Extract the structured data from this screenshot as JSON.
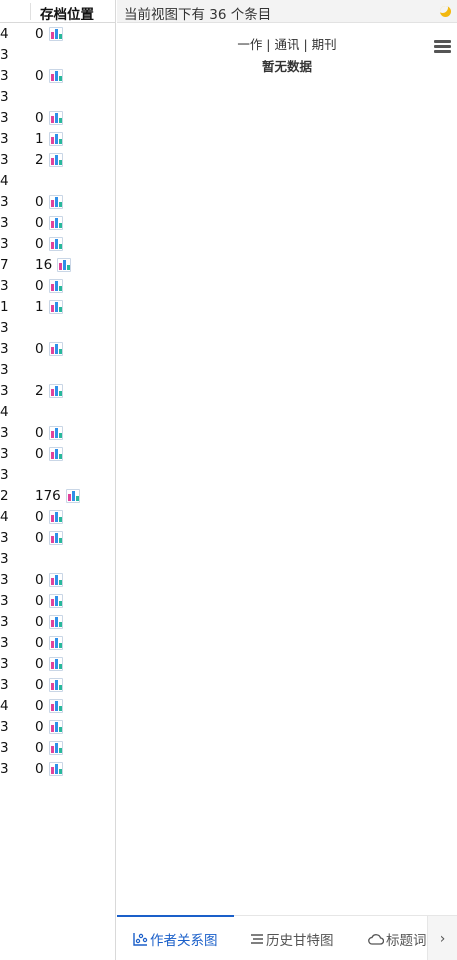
{
  "table": {
    "header": "存档位置",
    "rows": [
      {
        "c1": "4",
        "num": "0",
        "icon": true
      },
      {
        "c1": "3",
        "num": "",
        "icon": false
      },
      {
        "c1": "3",
        "num": "0",
        "icon": true
      },
      {
        "c1": "3",
        "num": "",
        "icon": false
      },
      {
        "c1": "3",
        "num": "0",
        "icon": true
      },
      {
        "c1": "3",
        "num": "1",
        "icon": true
      },
      {
        "c1": "3",
        "num": "2",
        "icon": true
      },
      {
        "c1": "4",
        "num": "",
        "icon": false
      },
      {
        "c1": "3",
        "num": "0",
        "icon": true
      },
      {
        "c1": "3",
        "num": "0",
        "icon": true
      },
      {
        "c1": "3",
        "num": "0",
        "icon": true
      },
      {
        "c1": "7",
        "num": "16",
        "icon": true
      },
      {
        "c1": "3",
        "num": "0",
        "icon": true
      },
      {
        "c1": "1",
        "num": "1",
        "icon": true
      },
      {
        "c1": "3",
        "num": "",
        "icon": false
      },
      {
        "c1": "3",
        "num": "0",
        "icon": true
      },
      {
        "c1": "3",
        "num": "",
        "icon": false
      },
      {
        "c1": "3",
        "num": "2",
        "icon": true
      },
      {
        "c1": "4",
        "num": "",
        "icon": false
      },
      {
        "c1": "3",
        "num": "0",
        "icon": true
      },
      {
        "c1": "3",
        "num": "0",
        "icon": true
      },
      {
        "c1": "3",
        "num": "",
        "icon": false
      },
      {
        "c1": "2",
        "num": "176",
        "icon": true
      },
      {
        "c1": "4",
        "num": "0",
        "icon": true
      },
      {
        "c1": "3",
        "num": "0",
        "icon": true
      },
      {
        "c1": "3",
        "num": "",
        "icon": false
      },
      {
        "c1": "3",
        "num": "0",
        "icon": true
      },
      {
        "c1": "3",
        "num": "0",
        "icon": true
      },
      {
        "c1": "3",
        "num": "0",
        "icon": true
      },
      {
        "c1": "3",
        "num": "0",
        "icon": true
      },
      {
        "c1": "3",
        "num": "0",
        "icon": true
      },
      {
        "c1": "3",
        "num": "0",
        "icon": true
      },
      {
        "c1": "4",
        "num": "0",
        "icon": true
      },
      {
        "c1": "3",
        "num": "0",
        "icon": true
      },
      {
        "c1": "3",
        "num": "0",
        "icon": true
      },
      {
        "c1": "3",
        "num": "0",
        "icon": true
      }
    ]
  },
  "topbar": {
    "status": "当前视图下有 36 个条目"
  },
  "chart": {
    "subtitle": "一作 | 通讯 | 期刊",
    "empty_text": "暂无数据"
  },
  "tabs": [
    {
      "label": "作者关系图",
      "icon": "network-chart-icon",
      "active": true
    },
    {
      "label": "历史甘特图",
      "icon": "gantt-icon",
      "active": false
    },
    {
      "label": "标题词",
      "icon": "cloud-icon",
      "active": false
    }
  ],
  "icons": {
    "row_icon": "bar-chart-icon",
    "topbar_icon": "moon-icon",
    "menu_icon": "hamburger-menu-icon",
    "next_icon": "chevron-right-icon"
  },
  "colors": {
    "accent": "#1a5fc9",
    "moon": "#f2b80e"
  }
}
